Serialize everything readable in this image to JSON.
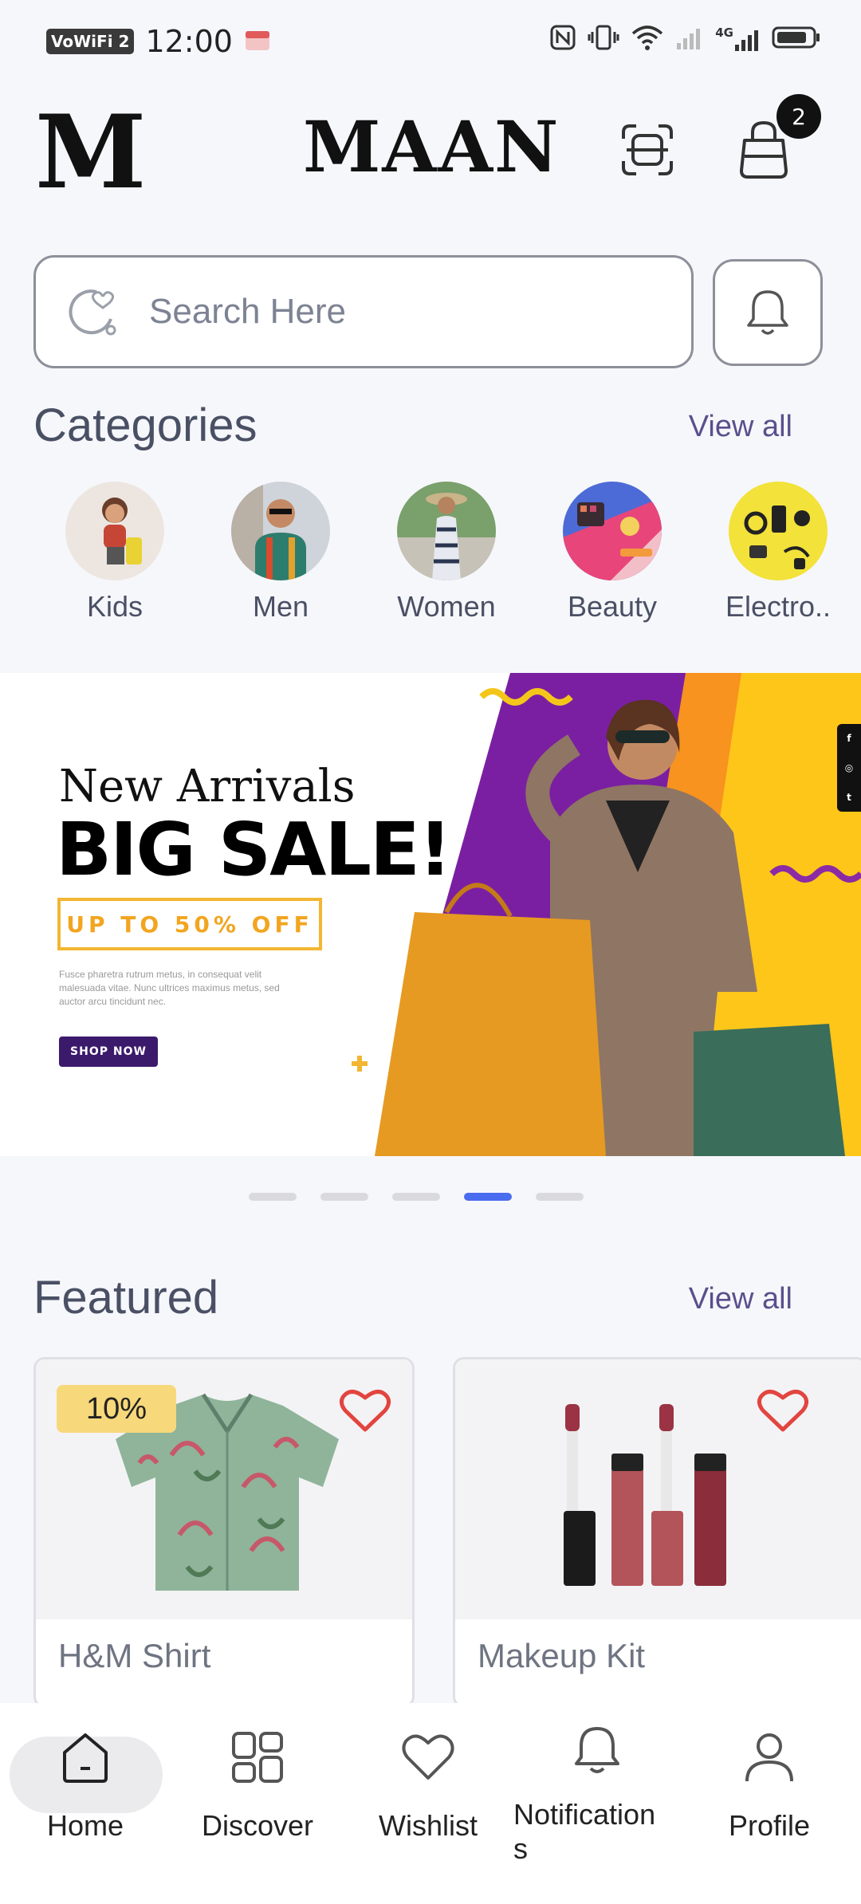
{
  "status_bar": {
    "wifi_badge": "VoWiFi",
    "sim": "2",
    "time": "12:00",
    "network": "4G"
  },
  "header": {
    "logo_letter": "M",
    "brand": "MAAN",
    "cart_count": "2"
  },
  "search": {
    "placeholder": "Search Here"
  },
  "categories": {
    "title": "Categories",
    "view_all": "View all",
    "items": [
      {
        "label": "Kids"
      },
      {
        "label": "Men"
      },
      {
        "label": "Women"
      },
      {
        "label": "Beauty"
      },
      {
        "label": "Electro.."
      }
    ]
  },
  "banner": {
    "subtitle": "New Arrivals",
    "title": "BIG SALE!",
    "offer": "UP TO 50% OFF",
    "body": "Fusce pharetra rutrum metus, in consequat velit malesuada vitae. Nunc ultrices maximus metus, sed auctor arcu tincidunt nec.",
    "cta": "SHOP NOW",
    "social": [
      "f",
      "◎",
      "t"
    ],
    "active_slide": 4,
    "slide_count": 5
  },
  "featured": {
    "title": "Featured",
    "view_all": "View all",
    "items": [
      {
        "name": "H&M Shirt",
        "discount": "10%"
      },
      {
        "name": "Makeup Kit"
      }
    ]
  },
  "bottom_nav": {
    "items": [
      {
        "label": "Home",
        "icon": "home-icon",
        "active": true
      },
      {
        "label": "Discover",
        "icon": "grid-icon"
      },
      {
        "label": "Wishlist",
        "icon": "heart-icon"
      },
      {
        "label": "Notification\ns",
        "icon": "bell-icon"
      },
      {
        "label": "Profile",
        "icon": "user-icon"
      }
    ]
  },
  "colors": {
    "accent_blue": "#4a6cf0",
    "view_all": "#5b4f8c",
    "heart_red": "#e2453f",
    "discount_bg": "#f7d87a",
    "banner_purple": "#7b1fa2",
    "banner_yellow": "#ffc61a"
  }
}
